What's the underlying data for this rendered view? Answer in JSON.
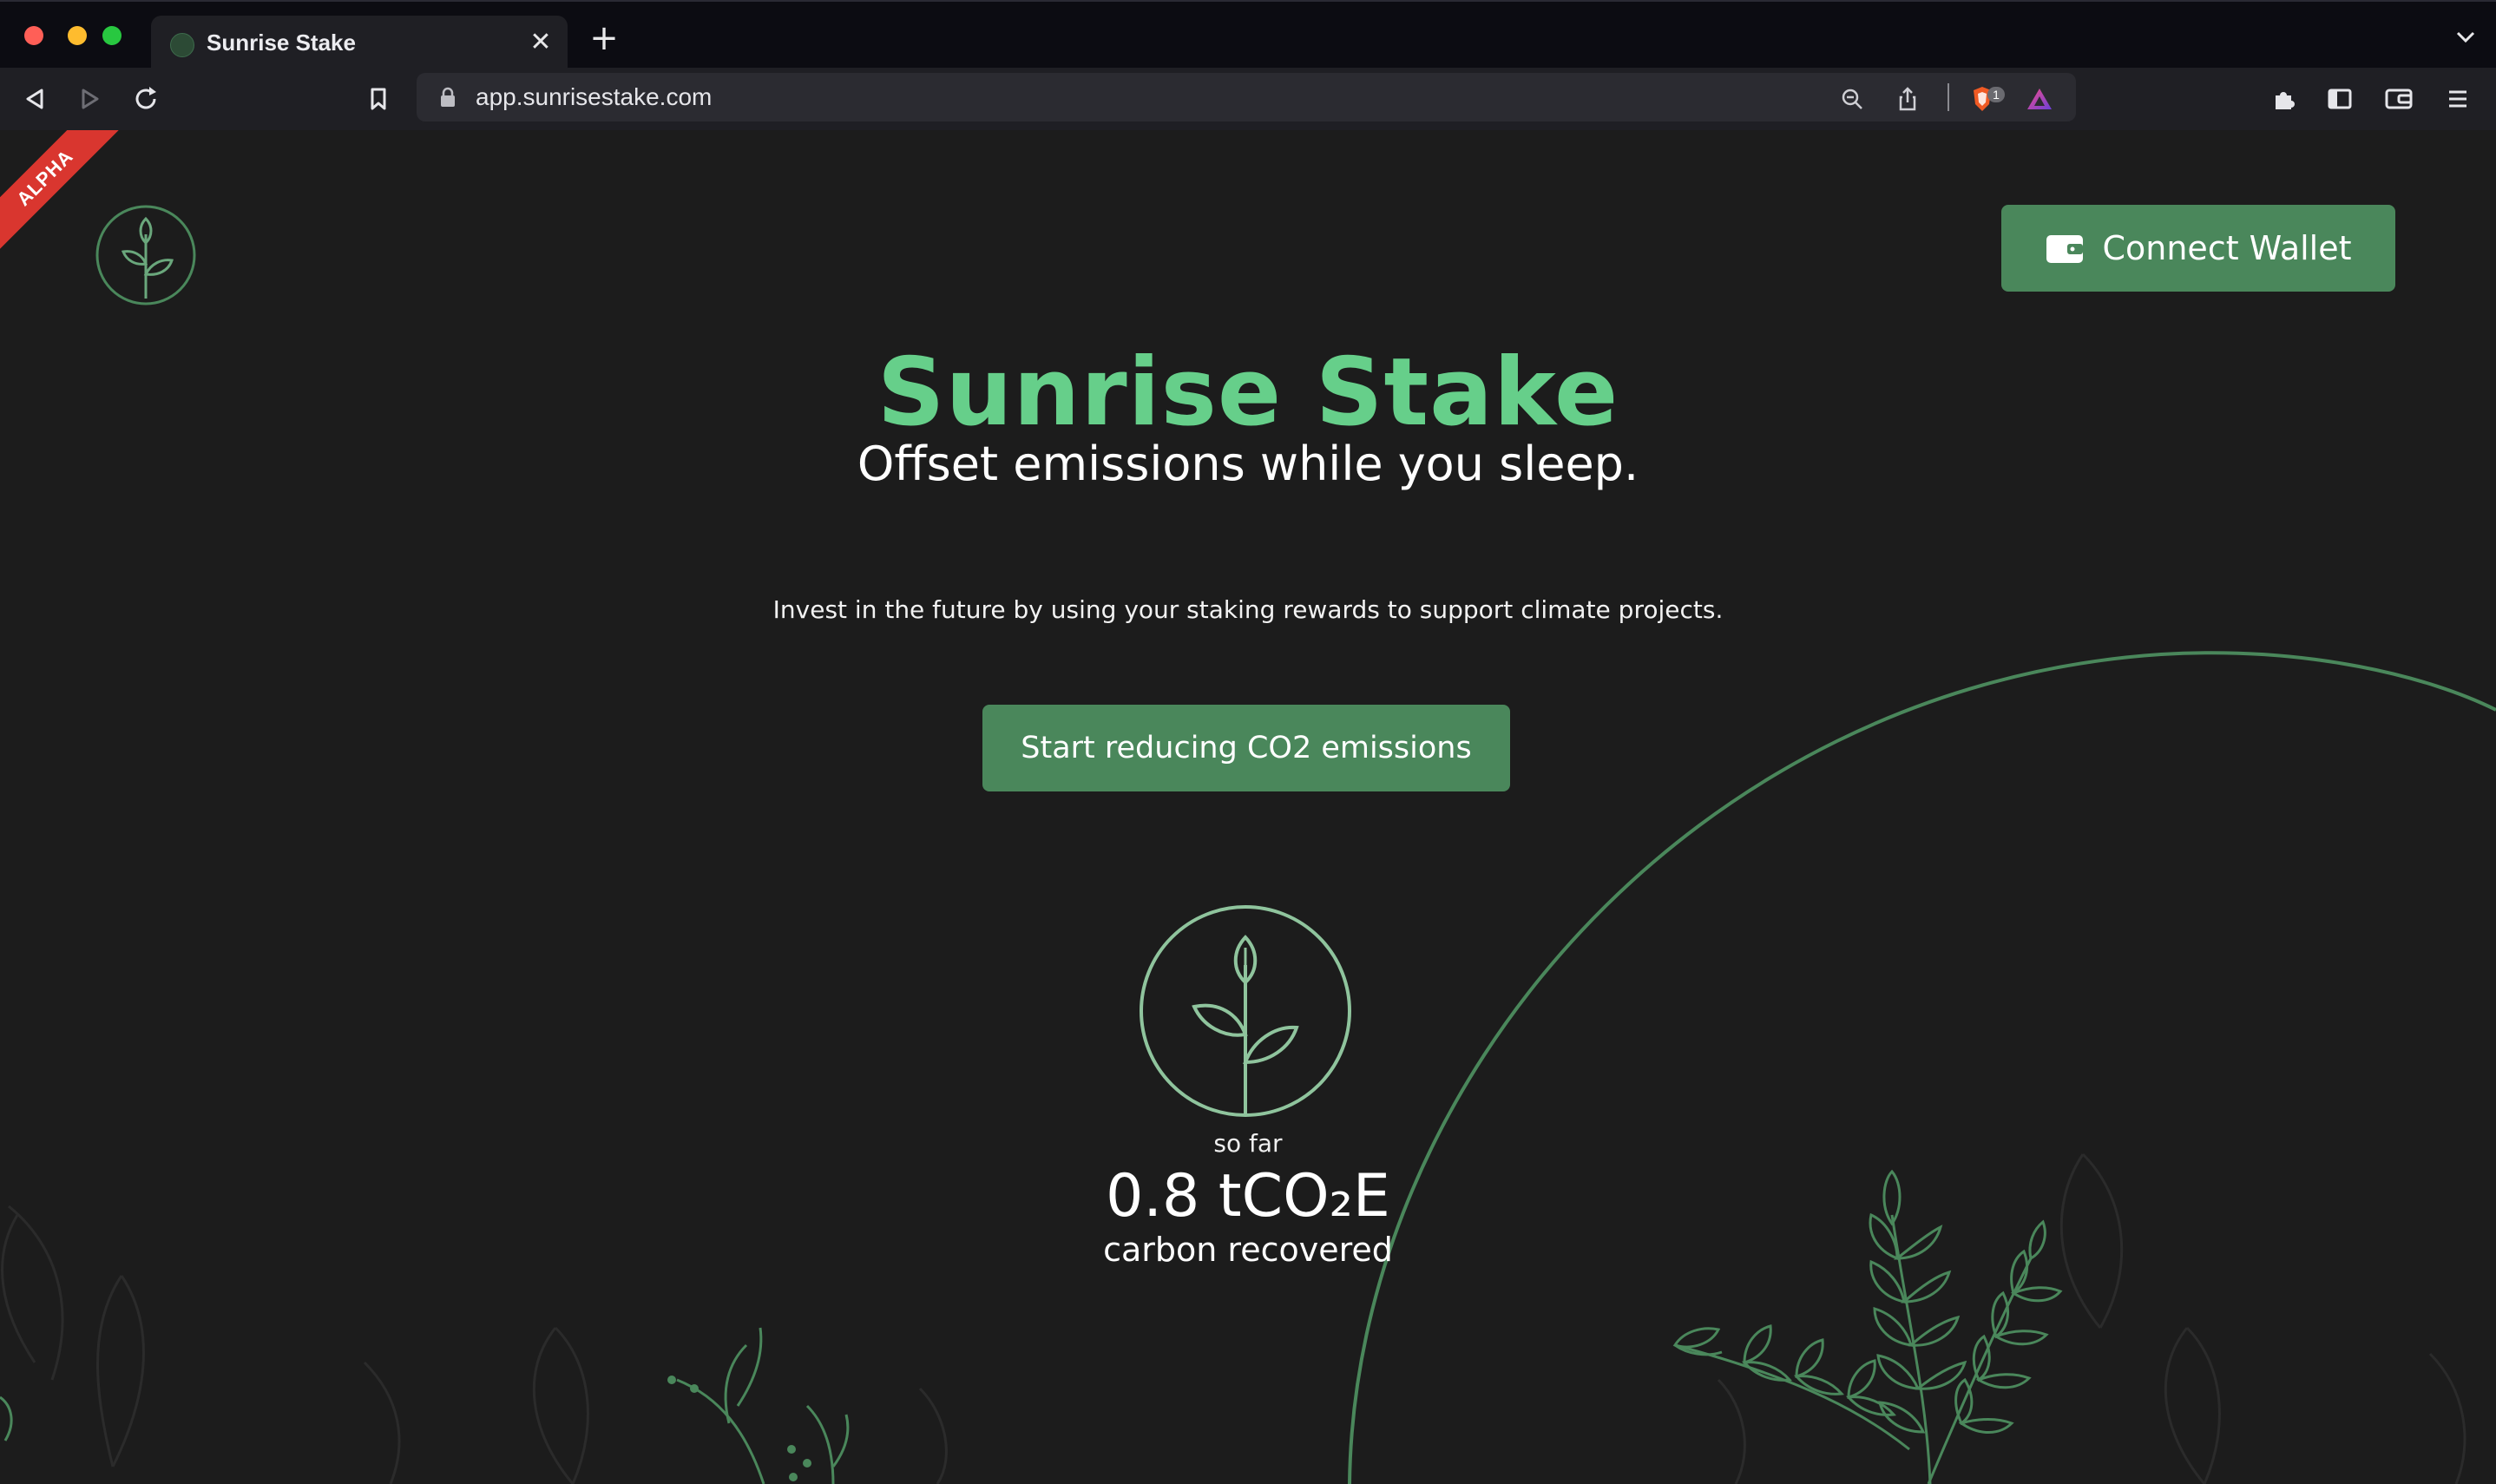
{
  "browser": {
    "tab_title": "Sunrise Stake",
    "close_glyph": "✕",
    "new_tab_glyph": "+",
    "url": "app.sunrisestake.com",
    "shield_badge": "1"
  },
  "page": {
    "ribbon": "ALPHA",
    "connect_button": "Connect Wallet",
    "title": "Sunrise Stake",
    "subtitle": "Offset emissions while you sleep.",
    "description": "Invest in the future by using your staking rewards to support climate projects.",
    "cta_button": "Start reducing CO2 emissions",
    "stats": {
      "prefix": "so far",
      "value": "0.8 tCO₂E",
      "suffix": "carbon recovered"
    }
  },
  "colors": {
    "accent": "#66cf8a",
    "button": "#4a875b",
    "background": "#1c1c1c",
    "ribbon": "#d9362f"
  },
  "icons": [
    "back-icon",
    "forward-icon",
    "reload-icon",
    "bookmark-icon",
    "lock-icon",
    "zoom-icon",
    "share-icon",
    "brave-shield-icon",
    "brave-rewards-icon",
    "extensions-icon",
    "sidebar-icon",
    "wallet-icon",
    "menu-icon",
    "sprout-logo-icon",
    "wallet-button-icon",
    "sprout-icon"
  ]
}
